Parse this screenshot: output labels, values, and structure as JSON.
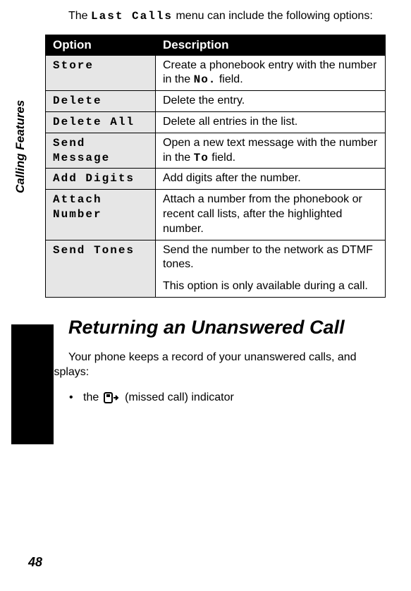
{
  "intro": {
    "pre": "The ",
    "menu": "Last Calls",
    "post": " menu can include the following options:"
  },
  "table": {
    "headers": {
      "option": "Option",
      "description": "Description"
    },
    "rows": [
      {
        "opt": "Store",
        "desc_pre": "Create a phonebook entry with the number in the ",
        "desc_ref": "No.",
        "desc_post": " field."
      },
      {
        "opt": "Delete",
        "desc": "Delete the entry."
      },
      {
        "opt": "Delete All",
        "desc": "Delete all entries in the list."
      },
      {
        "opt": "Send Message",
        "desc_pre": "Open a new text message with the number in the ",
        "desc_ref": "To",
        "desc_post": " field."
      },
      {
        "opt": "Add Digits",
        "desc": "Add digits after the number."
      },
      {
        "opt": "Attach Number",
        "desc": "Attach a number from the phonebook or recent call lists, after the highlighted number."
      },
      {
        "opt": "Send Tones",
        "desc": "Send the number to the network as DTMF tones.",
        "desc2": "This option is only available during a call."
      }
    ]
  },
  "sideLabel": "Calling Features",
  "section": {
    "title": "Returning an Unanswered Call",
    "body": "Your phone keeps a record of your unanswered calls, and displays:",
    "bullet_pre": "the ",
    "bullet_post": " (missed call) indicator"
  },
  "pageNumber": "48"
}
